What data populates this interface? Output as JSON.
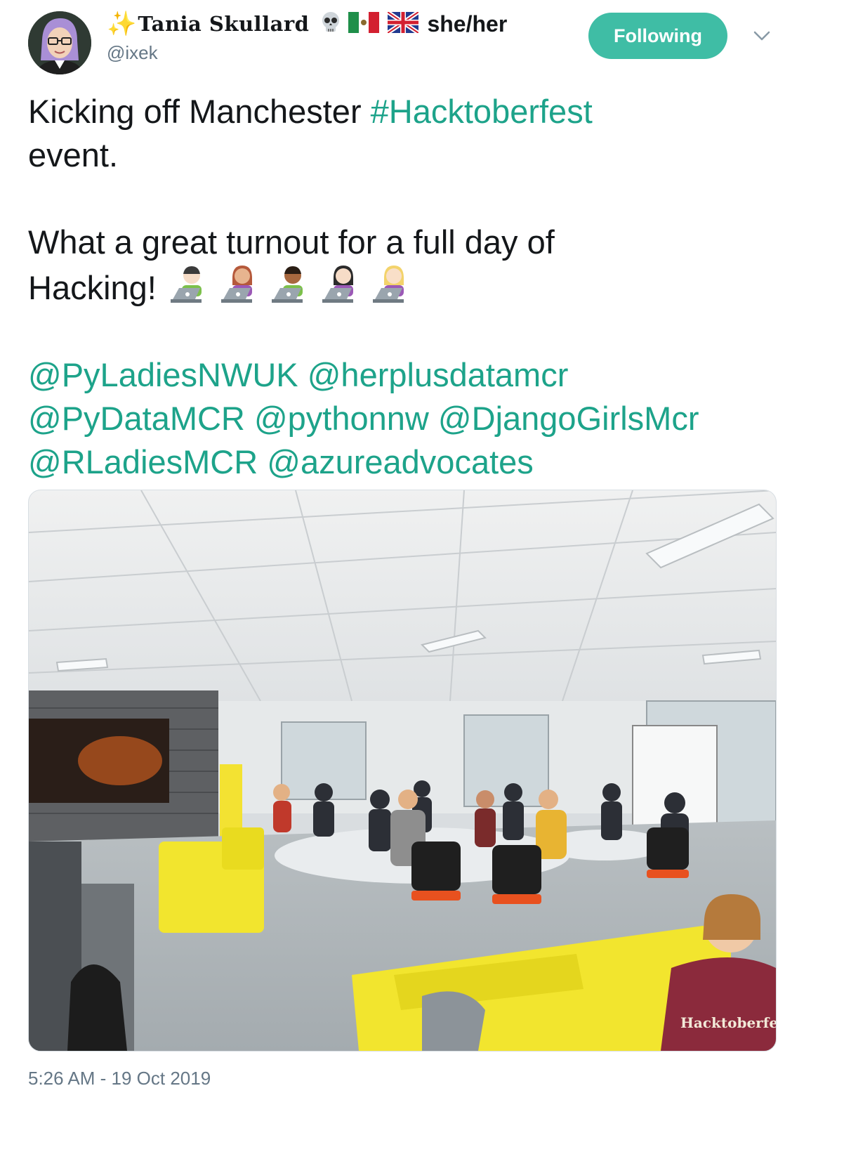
{
  "author": {
    "display_name": "Tania Skullard",
    "name_icons": [
      "sparkles-icon",
      "skull-icon",
      "mexico-flag-icon",
      "uk-flag-icon"
    ],
    "pronouns": "she/her",
    "handle": "@ixek"
  },
  "follow_button": {
    "label": "Following"
  },
  "tweet": {
    "line1_text": "Kicking off Manchester ",
    "hashtag": "#Hacktoberfest",
    "line2_text": "event.",
    "line3_text": "What a great turnout for a full day of",
    "line4_text": "Hacking!",
    "emojis": [
      "technologist-man-icon",
      "technologist-woman-icon",
      "technologist-man-dark-icon",
      "technologist-woman-light-icon",
      "technologist-woman-blonde-icon"
    ],
    "mentions_row1": [
      "@PyLadiesNWUK",
      "@herplusdatamcr"
    ],
    "mentions_row2": [
      "@PyDataMCR",
      "@pythonnw",
      "@DjangoGirlsMcr"
    ],
    "mentions_row3": [
      "@RLadiesMCR",
      "@azureadvocates"
    ]
  },
  "photo": {
    "shirt_text": "Hacktoberfest"
  },
  "timestamp": "5:26 AM - 19 Oct 2019",
  "colors": {
    "accent": "#3fbda5",
    "link": "#1da38a",
    "muted": "#657786"
  }
}
